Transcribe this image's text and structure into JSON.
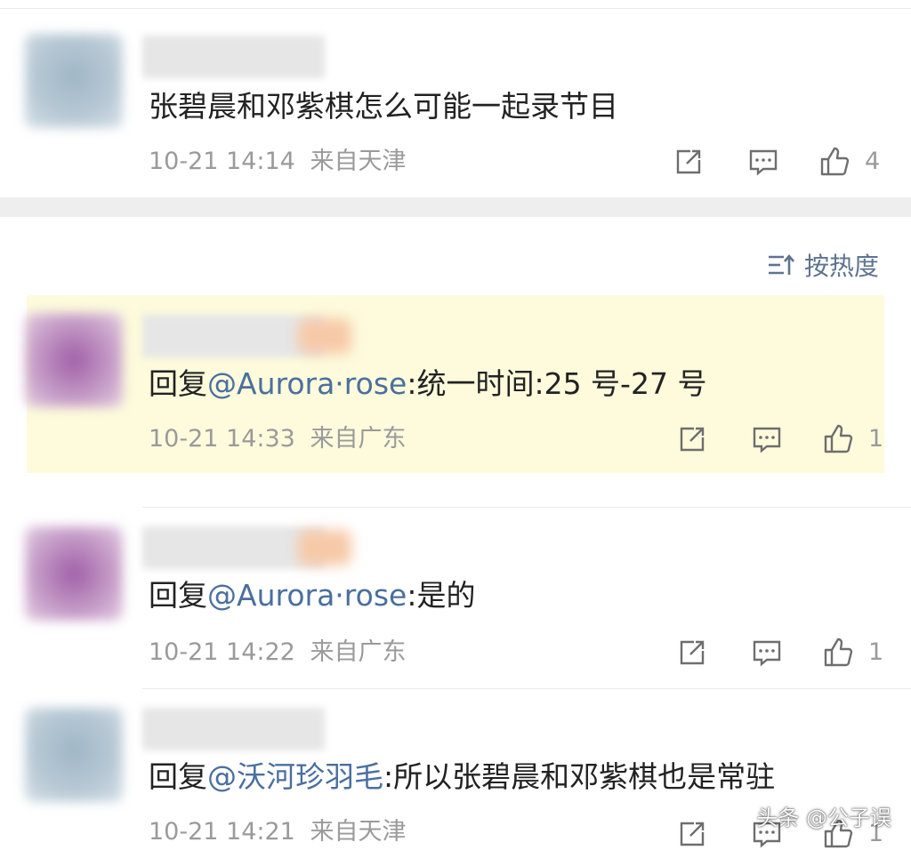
{
  "parent_comment": {
    "text": "张碧晨和邓紫棋怎么可能一起录节目",
    "time": "10-21 14:14",
    "location": "来自天津",
    "likes": "4"
  },
  "sort": {
    "label": "按热度"
  },
  "replies": [
    {
      "prefix": "回复",
      "mention": "@Aurora·rose",
      "body": ":统一时间:25 号-27 号",
      "time": "10-21 14:33",
      "location": "来自广东",
      "likes": "1"
    },
    {
      "prefix": "回复",
      "mention": "@Aurora·rose",
      "body": ":是的",
      "time": "10-21 14:22",
      "location": "来自广东",
      "likes": "1"
    },
    {
      "prefix": "回复",
      "mention": "@沃河珍羽毛",
      "body": ":所以张碧晨和邓紫棋也是常驻",
      "time": "10-21 14:21",
      "location": "来自天津",
      "likes": "1"
    }
  ],
  "watermark": "头条 @公子误",
  "colors": {
    "mention": "#4b6f9e",
    "highlight": "#fdfbdc",
    "meta": "#9a9a9a",
    "band": "#eeeeee"
  }
}
